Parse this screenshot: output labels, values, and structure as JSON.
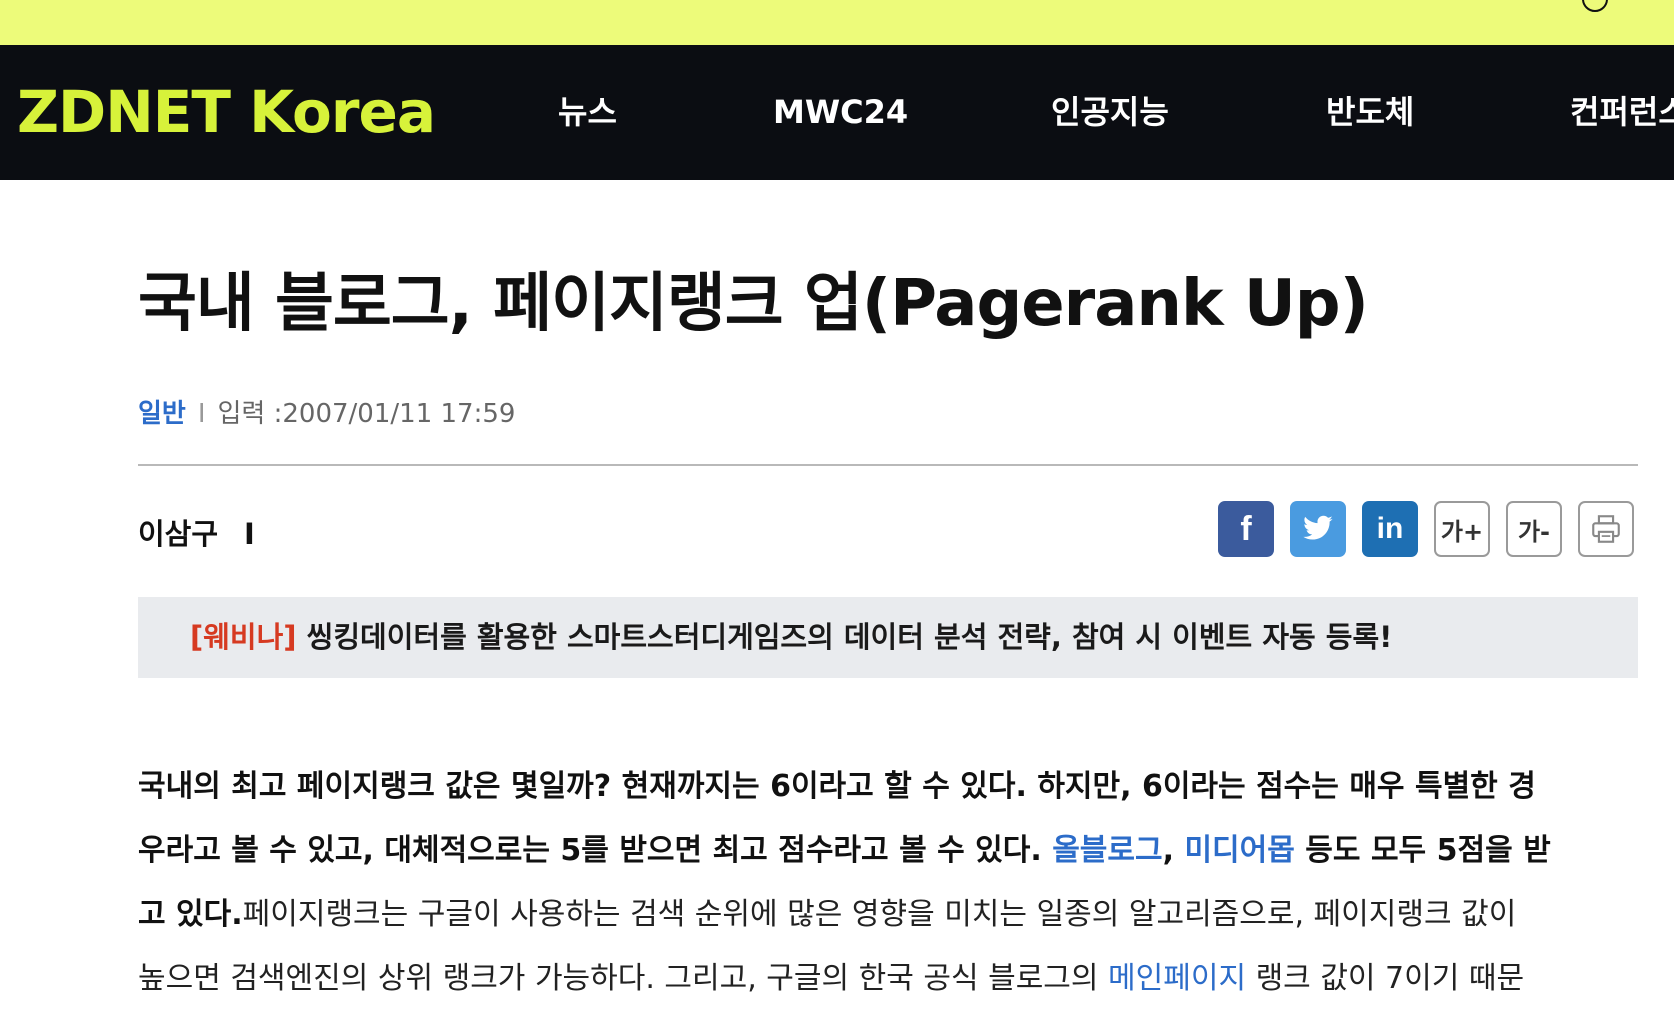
{
  "brand": {
    "logo": "ZDNET Korea"
  },
  "nav": {
    "items": [
      {
        "label": "뉴스"
      },
      {
        "label": "MWC24"
      },
      {
        "label": "인공지능"
      },
      {
        "label": "반도체"
      },
      {
        "label": "컨퍼런스"
      }
    ]
  },
  "article": {
    "title": "국내 블로그, 페이지랭크 업(Pagerank Up)",
    "category": "일반",
    "separator": "I",
    "date_label": "입력 :2007/01/11 17:59",
    "author": "이삼구",
    "author_separator": "I"
  },
  "share": {
    "facebook": "f",
    "linkedin": "in",
    "font_up": "가+",
    "font_down": "가-"
  },
  "promo": {
    "tag": "[웨비나]",
    "text": "씽킹데이터를 활용한 스마트스터디게임즈의 데이터 분석 전략, 참여 시 이벤트 자동 등록!"
  },
  "body": {
    "l1": "국내의 최고 페이지랭크 값은 몇일까? 현재까지는 6이라고 할 수 있다. 하지만, 6이라는 점수는 매우 특별한 경",
    "l2_a": "우라고 볼 수 있고, 대체적으로는 5를 받으면 최고 점수라고 볼 수 있다. ",
    "l2_link1": "올블로그",
    "l2_comma": ", ",
    "l2_link2": "미디어몹",
    "l2_b": " 등도 모두 5점을 받",
    "l3_bold": "고 있다.",
    "l3_rest": "페이지랭크는 구글이 사용하는 검색 순위에 많은 영향을 미치는 일종의 알고리즘으로, 페이지랭크 값이",
    "l4_a": "높으면 검색엔진의 상위 랭크가 가능하다. 그리고, 구글의 한국 공식 블로그의 ",
    "l4_link": "메인페이지",
    "l4_b": " 랭크 값이 7이기 때문"
  }
}
